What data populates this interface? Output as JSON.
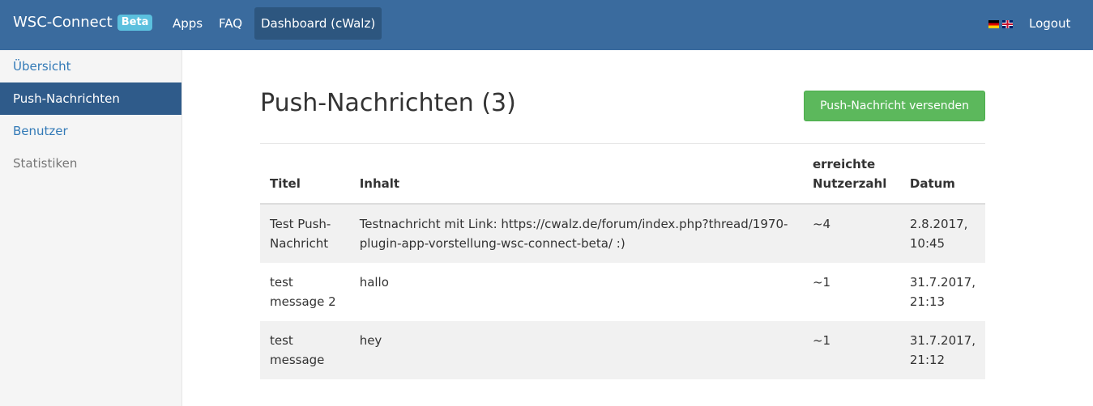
{
  "navbar": {
    "brand": "WSC-Connect",
    "badge": "Beta",
    "links": [
      "Apps",
      "FAQ",
      "Dashboard (cWalz)"
    ],
    "logout": "Logout",
    "color": "#3a6b9e"
  },
  "sidebar": {
    "items": [
      {
        "label": "Übersicht"
      },
      {
        "label": "Push-Nachrichten"
      },
      {
        "label": "Benutzer"
      },
      {
        "label": "Statistiken"
      }
    ]
  },
  "main": {
    "title": "Push-Nachrichten (3)",
    "send_button": "Push-Nachricht versenden",
    "table": {
      "headers": [
        "Titel",
        "Inhalt",
        "erreichte Nutzerzahl",
        "Datum"
      ],
      "rows": [
        {
          "title": "Test Push-Nachricht",
          "content": "Testnachricht mit Link: https://cwalz.de/forum/index.php?thread/1970-plugin-app-vorstellung-wsc-connect-beta/ :)",
          "reach": "~4",
          "date": "2.8.2017, 10:45"
        },
        {
          "title": "test message 2",
          "content": "hallo",
          "reach": "~1",
          "date": "31.7.2017, 21:13"
        },
        {
          "title": "test message",
          "content": "hey",
          "reach": "~1",
          "date": "31.7.2017, 21:12"
        }
      ]
    }
  }
}
